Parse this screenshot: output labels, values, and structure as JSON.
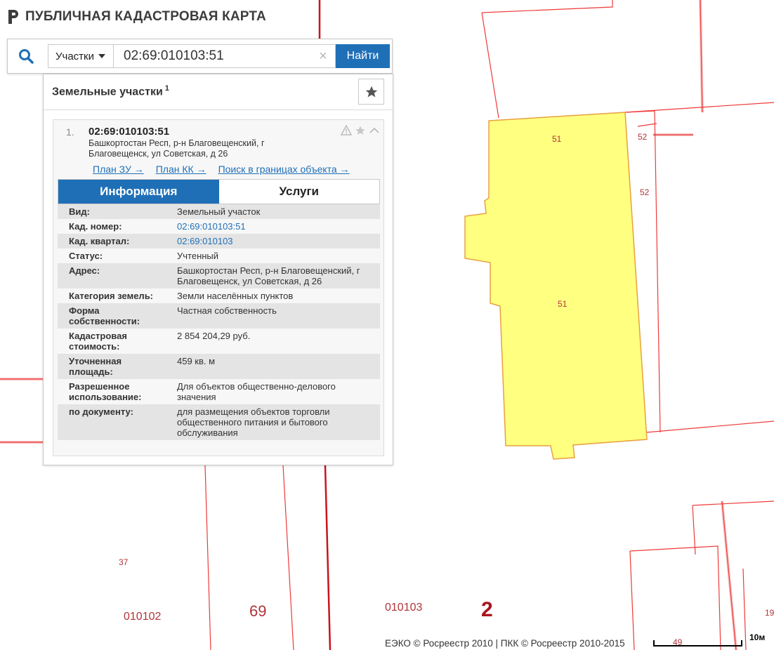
{
  "app": {
    "title": "ПУБЛИЧНАЯ КАДАСТРОВАЯ КАРТА"
  },
  "search": {
    "type_label": "Участки",
    "query": "02:69:010103:51",
    "clear_symbol": "×",
    "find_label": "Найти"
  },
  "results": {
    "title": "Земельные участки",
    "count": "1",
    "items": [
      {
        "number": "1.",
        "cad_number": "02:69:010103:51",
        "address": "Башкортостан Респ, р-н Благовещенский, г Благовещенск, ул Советская, д 26",
        "links": [
          "План ЗУ →",
          "План КК →",
          "Поиск в границах объекта →"
        ],
        "tabs": [
          "Информация",
          "Услуги"
        ],
        "info": [
          {
            "key": "Вид:",
            "value": "Земельный участок",
            "link": false
          },
          {
            "key": "Кад. номер:",
            "value": "02:69:010103:51",
            "link": true
          },
          {
            "key": "Кад. квартал:",
            "value": "02:69:010103",
            "link": true
          },
          {
            "key": "Статус:",
            "value": "Учтенный",
            "link": false
          },
          {
            "key": "Адрес:",
            "value": "Башкортостан Респ, р-н Благовещенский, г Благовещенск, ул Советская, д 26",
            "link": false
          },
          {
            "key": "Категория земель:",
            "value": "Земли населённых пунктов",
            "link": false
          },
          {
            "key": "Форма собственности:",
            "value": "Частная собственность",
            "link": false
          },
          {
            "key": "Кадастровая стоимость:",
            "value": "2 854 204,29 руб.",
            "link": false
          },
          {
            "key": "Уточненная площадь:",
            "value": "459 кв. м",
            "link": false
          },
          {
            "key": "Разрешенное использование:",
            "value": "Для объектов общественно-делового значения",
            "link": false
          },
          {
            "key": "по документу:",
            "value": "для размещения объектов торговли общественного питания и бытового обслуживания",
            "link": false
          }
        ]
      }
    ]
  },
  "map": {
    "labels": {
      "parcel_top": "51",
      "parcel_main": "51",
      "neighbor_top": "52",
      "neighbor_mid": "52",
      "l37": "37",
      "block_left": "010102",
      "district": "69",
      "block_right": "010103",
      "region": "2",
      "l19": "19",
      "l49": "49"
    },
    "colors": {
      "parcel_fill": "#ffff80",
      "parcel_stroke": "#e8a040",
      "boundary": "#ee3a3a",
      "district_line": "#c8141d"
    }
  },
  "footer": {
    "copyright": "ЕЭКО © Росреестр 2010 | ПКК © Росреестр 2010-2015",
    "scale": "10м"
  }
}
